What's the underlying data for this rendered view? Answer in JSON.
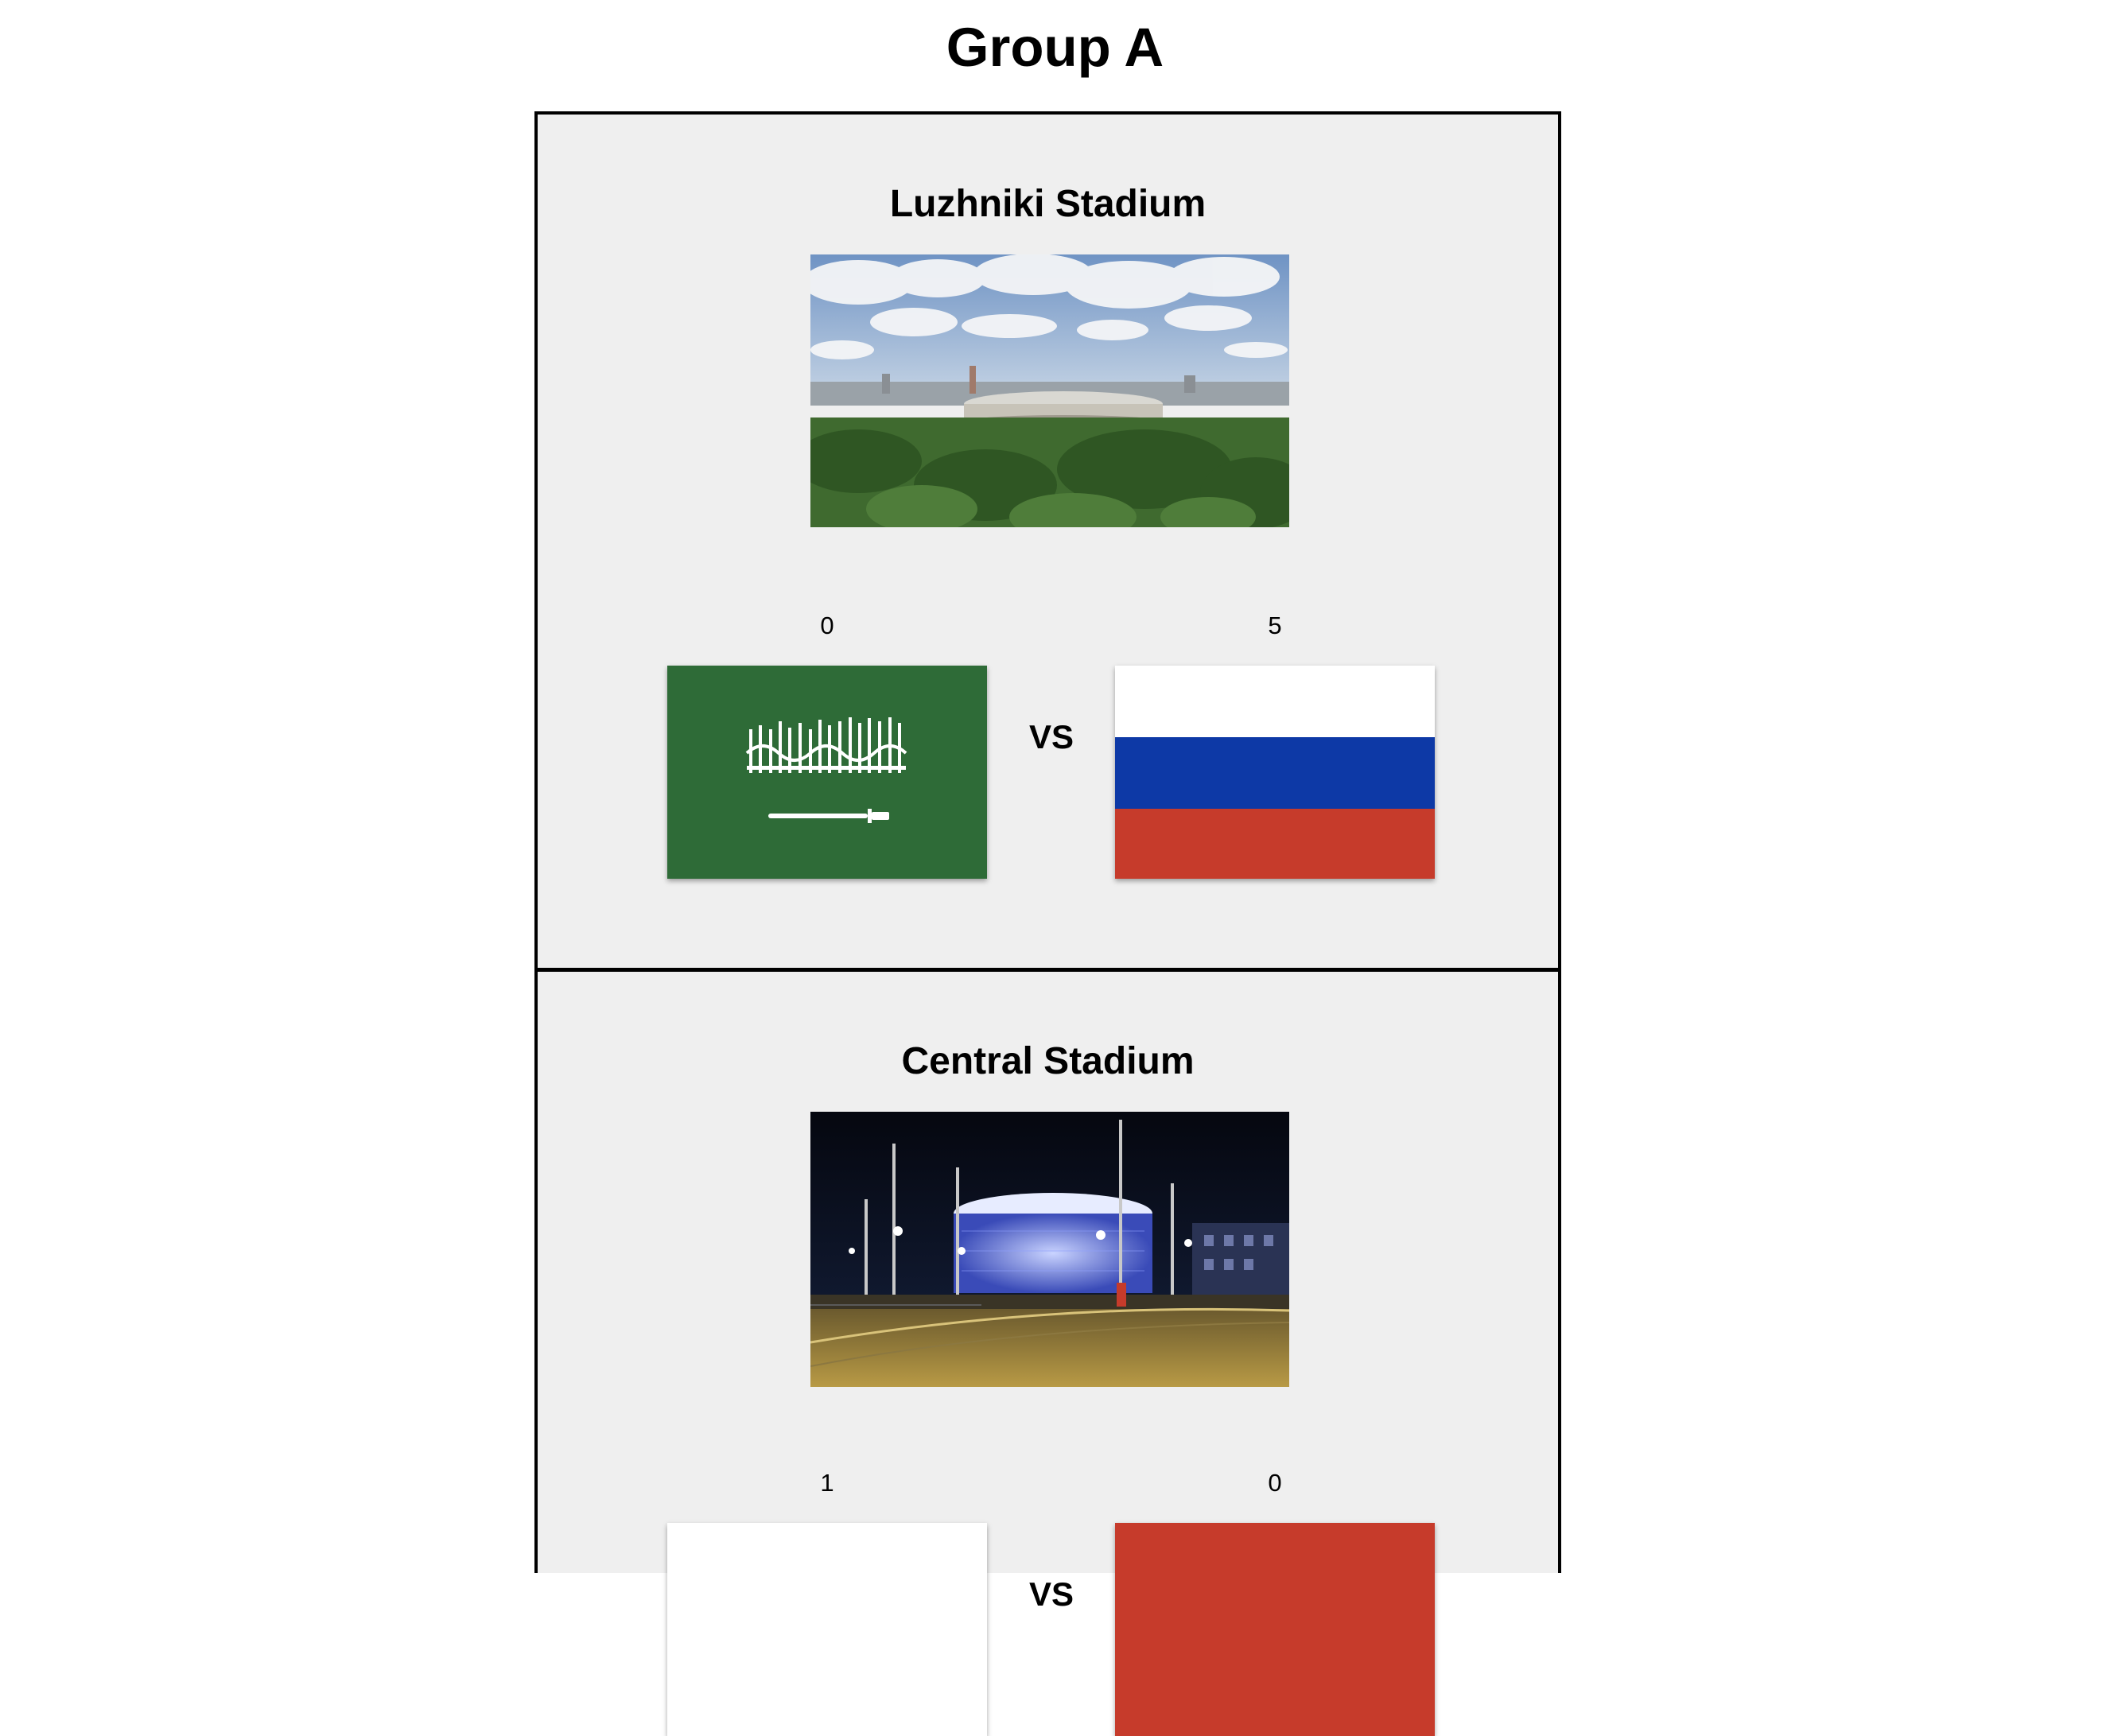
{
  "page": {
    "title": "Group A"
  },
  "matches": [
    {
      "stadium": "Luzhniki Stadium",
      "photo": "luzhniki-stadium-photo",
      "vs_label": "VS",
      "home": {
        "score": "0",
        "flag": "saudi-arabia-flag"
      },
      "away": {
        "score": "5",
        "flag": "russia-flag"
      }
    },
    {
      "stadium": "Central Stadium",
      "photo": "central-stadium-photo",
      "vs_label": "VS",
      "home": {
        "score": "1",
        "flag": "white-flag-partial"
      },
      "away": {
        "score": "0",
        "flag": "red-flag-partial"
      }
    }
  ],
  "colors": {
    "card_background": "#efefef",
    "saudi_green": "#2e6b37",
    "russia_white": "#ffffff",
    "russia_blue": "#0d39a6",
    "russia_red": "#c63b2b"
  }
}
